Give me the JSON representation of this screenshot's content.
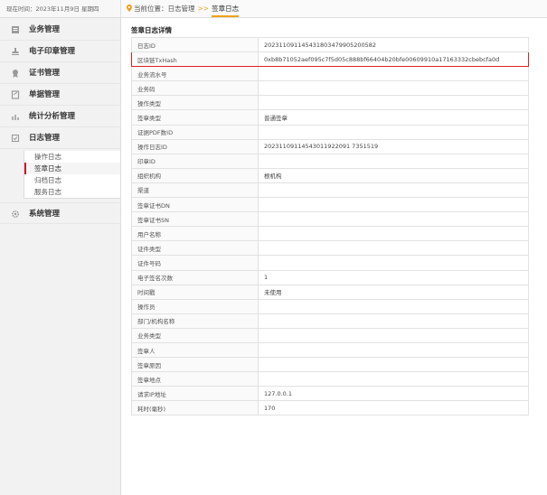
{
  "sidebar": {
    "date_text": "现在时间：2023年11月9日 星期四",
    "menu": [
      {
        "label": "业务管理",
        "icon": "list-icon"
      },
      {
        "label": "电子印章管理",
        "icon": "stamp-icon"
      },
      {
        "label": "证书管理",
        "icon": "certificate-icon"
      },
      {
        "label": "单据管理",
        "icon": "document-icon"
      },
      {
        "label": "统计分析管理",
        "icon": "bar-chart-icon"
      },
      {
        "label": "日志管理",
        "icon": "log-icon"
      },
      {
        "label": "系统管理",
        "icon": "gear-icon"
      }
    ],
    "log_submenu": [
      "操作日志",
      "签章日志",
      "归档日志",
      "服务日志"
    ]
  },
  "breadcrumb": {
    "prefix": "当前位置：",
    "parent": "日志管理",
    "separator": ">>",
    "current": "签章日志"
  },
  "detail": {
    "title": "签章日志详情",
    "rows": [
      {
        "label": "日志ID",
        "value": "202311091145431803479905200582"
      },
      {
        "label": "区块链TxHash",
        "value": "0xb8b71052aef095c7f5d05c888bf66404b20bfe00609910a17163332cbebcfa0d"
      },
      {
        "label": "业务流水号",
        "value": ""
      },
      {
        "label": "业务码",
        "value": ""
      },
      {
        "label": "操作类型",
        "value": ""
      },
      {
        "label": "签章类型",
        "value": "普通签章"
      },
      {
        "label": "证据PDF数ID",
        "value": ""
      },
      {
        "label": "操作日志ID",
        "value": "20231109114543011922091 7351519"
      },
      {
        "label": "印章ID",
        "value": ""
      },
      {
        "label": "组织机构",
        "value": "根机构"
      },
      {
        "label": "渠道",
        "value": ""
      },
      {
        "label": "签章证书DN",
        "value": ""
      },
      {
        "label": "签章证书SN",
        "value": ""
      },
      {
        "label": "用户名称",
        "value": ""
      },
      {
        "label": "证件类型",
        "value": ""
      },
      {
        "label": "证件号码",
        "value": ""
      },
      {
        "label": "电子签名次数",
        "value": "1"
      },
      {
        "label": "时间戳",
        "value": "未使用"
      },
      {
        "label": "操作员",
        "value": ""
      },
      {
        "label": "部门/机构名称",
        "value": ""
      },
      {
        "label": "业务类型",
        "value": ""
      },
      {
        "label": "签章人",
        "value": ""
      },
      {
        "label": "签章原因",
        "value": ""
      },
      {
        "label": "签章地点",
        "value": ""
      },
      {
        "label": "请求IP地址",
        "value": "127.0.0.1"
      },
      {
        "label": "耗时(毫秒)",
        "value": "170"
      }
    ]
  },
  "colors": {
    "accent": "#f0a020",
    "highlight_border": "#e02020",
    "active_marker": "#c8102e"
  }
}
